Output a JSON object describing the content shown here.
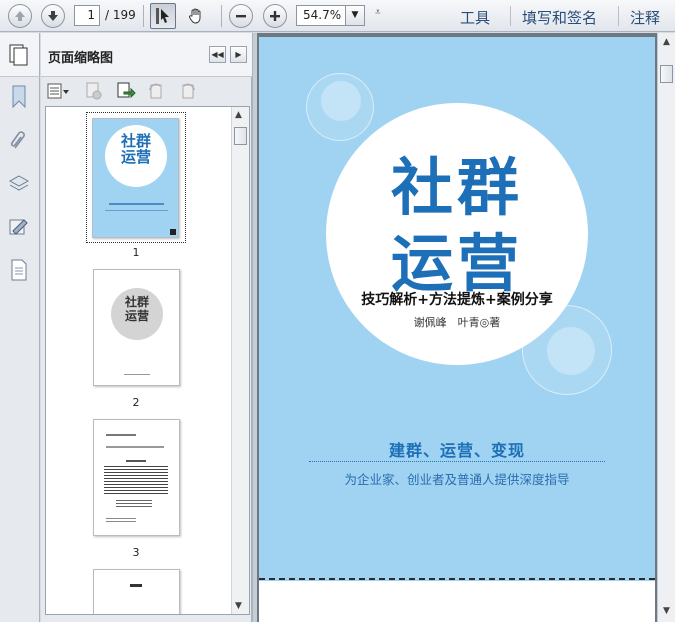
{
  "toolbar": {
    "page_current": "1",
    "page_total": "/ 199",
    "zoom": "54.7%",
    "links": {
      "tools": "工具",
      "fill_sign": "填写和签名",
      "comment": "注释"
    }
  },
  "panel": {
    "title": "页面缩略图",
    "thumbnails": [
      {
        "label": "1"
      },
      {
        "label": "2"
      },
      {
        "label": "3"
      }
    ]
  },
  "cover": {
    "title_line1": "社群",
    "title_line2": "运营",
    "subtitle": "技巧解析+方法提炼+案例分享",
    "authors": "谢佩峰　叶青◎著",
    "tagline": "建群、运营、变现",
    "tagline2": "为企业家、创业者及普通人提供深度指导",
    "colors": {
      "background": "#9fd3f1",
      "title": "#1d6fb7"
    }
  },
  "icons": {
    "toolbar": [
      "arrow-up-icon",
      "arrow-down-icon",
      "select-cursor-icon",
      "hand-icon",
      "zoom-out-icon",
      "zoom-in-icon",
      "chevron-down-icon"
    ],
    "rail": [
      "pages-icon",
      "bookmark-icon",
      "paperclip-icon",
      "layers-icon",
      "signature-icon",
      "document-icon"
    ]
  }
}
